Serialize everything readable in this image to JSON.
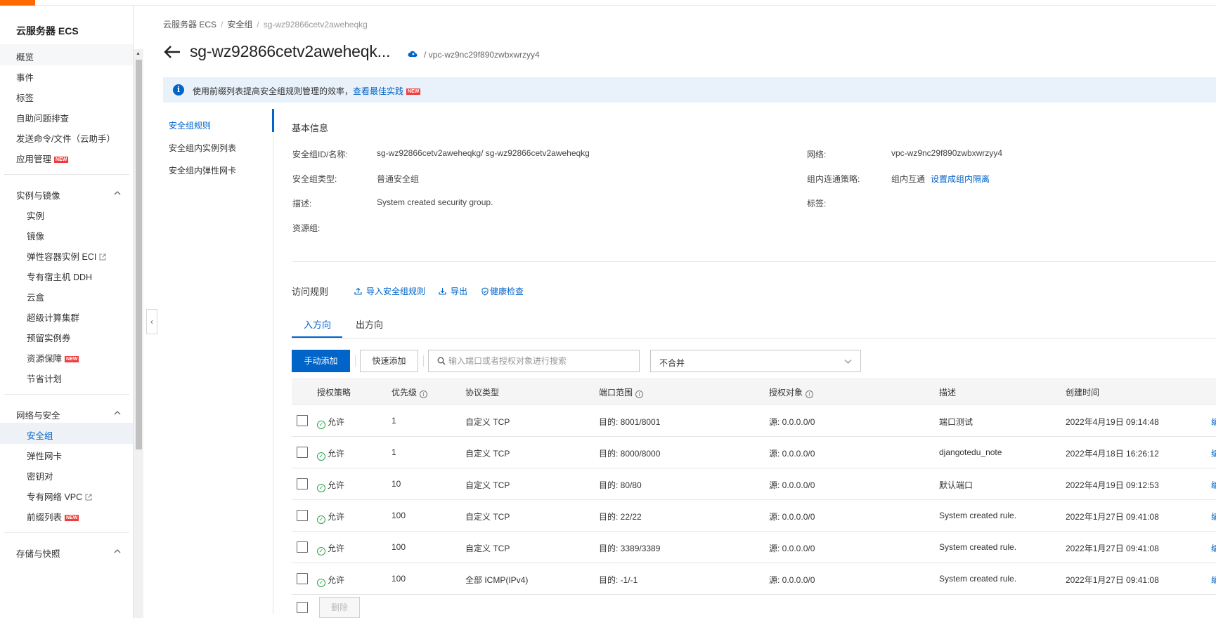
{
  "sidebar": {
    "title": "云服务器 ECS",
    "items_top": [
      {
        "label": "概览"
      },
      {
        "label": "事件"
      },
      {
        "label": "标签"
      },
      {
        "label": "自助问题排查"
      },
      {
        "label": "发送命令/文件（云助手）"
      },
      {
        "label": "应用管理",
        "badge": "NEW"
      }
    ],
    "group_instances": {
      "label": "实例与镜像",
      "items": [
        {
          "label": "实例"
        },
        {
          "label": "镜像"
        },
        {
          "label": "弹性容器实例 ECI"
        },
        {
          "label": "专有宿主机 DDH"
        },
        {
          "label": "云盒"
        },
        {
          "label": "超级计算集群"
        },
        {
          "label": "预留实例券"
        },
        {
          "label": "资源保障",
          "badge": "NEW"
        },
        {
          "label": "节省计划"
        }
      ]
    },
    "group_network": {
      "label": "网络与安全",
      "items": [
        {
          "label": "安全组"
        },
        {
          "label": "弹性网卡"
        },
        {
          "label": "密钥对"
        },
        {
          "label": "专有网络 VPC"
        },
        {
          "label": "前缀列表",
          "badge": "NEW"
        }
      ]
    },
    "group_storage": {
      "label": "存储与快照"
    }
  },
  "breadcrumb": {
    "items": [
      "云服务器 ECS",
      "安全组",
      "sg-wz92866cetv2aweheqkg"
    ]
  },
  "header": {
    "title": "sg-wz92866cetv2aweheqk...",
    "vpc": "/ vpc-wz9nc29f890zwbxwrzyy4"
  },
  "notice": {
    "text": "使用前缀列表提高安全组规则管理的效率，",
    "link": "查看最佳实践",
    "badge": "NEW",
    "icon": "info-icon"
  },
  "subnav": {
    "items": [
      {
        "label": "安全组规则"
      },
      {
        "label": "安全组内实例列表"
      },
      {
        "label": "安全组内弹性网卡"
      }
    ]
  },
  "basic_info": {
    "title": "基本信息",
    "id_label": "安全组ID/名称:",
    "id_value": "sg-wz92866cetv2aweheqkg/ sg-wz92866cetv2aweheqkg",
    "type_label": "安全组类型:",
    "type_value": "普通安全组",
    "desc_label": "描述:",
    "desc_value": "System created security group.",
    "rg_label": "资源组:",
    "network_label": "网络:",
    "network_value": "vpc-wz9nc29f890zwbxwrzyy4",
    "policy_label": "组内连通策略:",
    "policy_value": "组内互通",
    "policy_link": "设置成组内隔离",
    "tags_label": "标签:"
  },
  "rules": {
    "title": "访问规则",
    "import": "导入安全组规则",
    "export": "导出",
    "health": "健康检查",
    "tabs": [
      "入方向",
      "出方向"
    ],
    "add_manual": "手动添加",
    "add_quick": "快速添加",
    "search_placeholder": "输入端口或者授权对象进行搜索",
    "merge_select": "不合并",
    "columns": [
      "授权策略",
      "优先级",
      "协议类型",
      "端口范围",
      "授权对象",
      "描述",
      "创建时间"
    ],
    "rows": [
      {
        "policy": "允许",
        "priority": "1",
        "protocol": "自定义 TCP",
        "port": "目的: 8001/8001",
        "source": "源: 0.0.0.0/0",
        "desc": "端口测试",
        "created": "2022年4月19日 09:14:48"
      },
      {
        "policy": "允许",
        "priority": "1",
        "protocol": "自定义 TCP",
        "port": "目的: 8000/8000",
        "source": "源: 0.0.0.0/0",
        "desc": "djangotedu_note",
        "created": "2022年4月18日 16:26:12"
      },
      {
        "policy": "允许",
        "priority": "10",
        "protocol": "自定义 TCP",
        "port": "目的: 80/80",
        "source": "源: 0.0.0.0/0",
        "desc": "默认端口",
        "created": "2022年4月19日 09:12:53"
      },
      {
        "policy": "允许",
        "priority": "100",
        "protocol": "自定义 TCP",
        "port": "目的: 22/22",
        "source": "源: 0.0.0.0/0",
        "desc": "System created rule.",
        "created": "2022年1月27日 09:41:08"
      },
      {
        "policy": "允许",
        "priority": "100",
        "protocol": "自定义 TCP",
        "port": "目的: 3389/3389",
        "source": "源: 0.0.0.0/0",
        "desc": "System created rule.",
        "created": "2022年1月27日 09:41:08"
      },
      {
        "policy": "允许",
        "priority": "100",
        "protocol": "全部 ICMP(IPv4)",
        "port": "目的: -1/-1",
        "source": "源: 0.0.0.0/0",
        "desc": "System created rule.",
        "created": "2022年1月27日 09:41:08"
      }
    ],
    "delete": "删除",
    "edge_link": "编"
  },
  "colors": {
    "accent": "#0064c8",
    "brand": "#ff6a00",
    "allow": "#2ba24c",
    "new_badge": "#f23c3c"
  }
}
